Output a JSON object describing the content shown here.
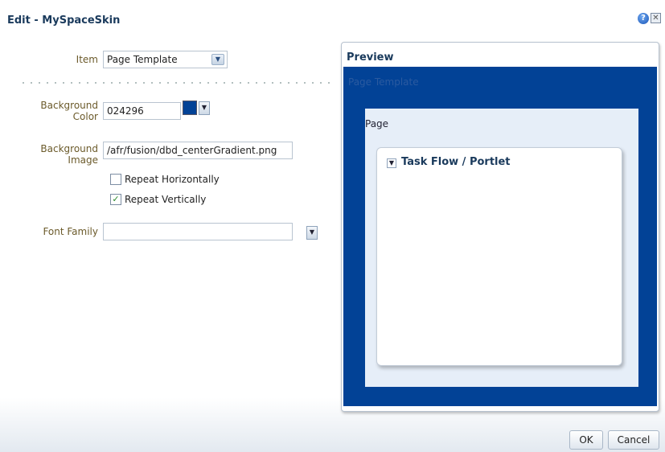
{
  "dialog": {
    "title": "Edit - MySpaceSkin",
    "help_icon_glyph": "?",
    "close_icon_glyph": "✕"
  },
  "form": {
    "item_label": "Item",
    "item_value": "Page Template",
    "bg_color_label_1": "Background",
    "bg_color_label_2": "Color",
    "bg_color_value": "024296",
    "bg_color_swatch": "#024296",
    "bg_image_label_1": "Background",
    "bg_image_label_2": "Image",
    "bg_image_value": "/afr/fusion/dbd_centerGradient.png",
    "repeat_h_label": "Repeat Horizontally",
    "repeat_h_checked": false,
    "repeat_v_label": "Repeat Vertically",
    "repeat_v_checked": true,
    "font_family_label": "Font Family",
    "font_family_value": ""
  },
  "preview": {
    "title": "Preview",
    "page_template_label": "Page Template",
    "page_label": "Page",
    "portlet_title": "Task Flow / Portlet",
    "bg_color": "#024296"
  },
  "footer": {
    "ok_label": "OK",
    "cancel_label": "Cancel"
  }
}
